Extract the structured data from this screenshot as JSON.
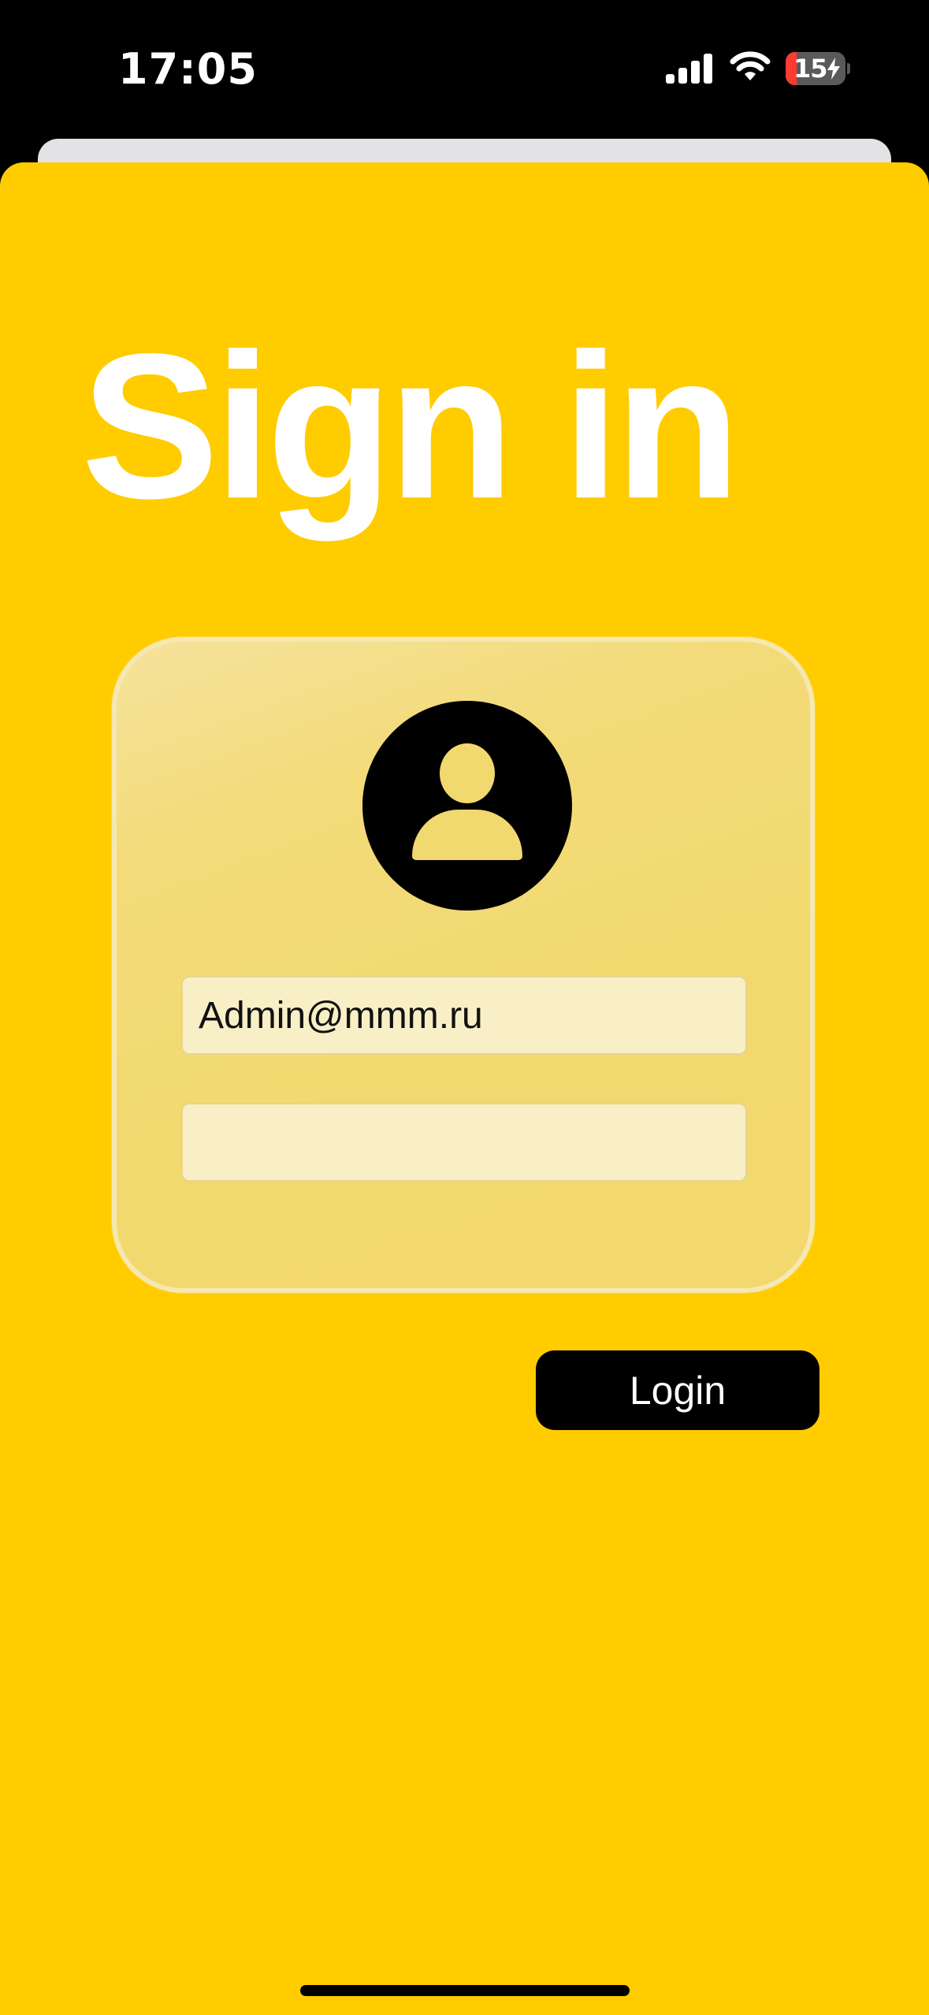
{
  "status_bar": {
    "time": "17:05",
    "battery_level": "15",
    "battery_charging": true,
    "icons": [
      "cellular-signal-icon",
      "wifi-icon",
      "battery-icon",
      "charging-bolt-icon"
    ]
  },
  "screen": {
    "title": "Sign in",
    "background_color": "#ffcc00",
    "card_color": "#f2d96f"
  },
  "form": {
    "avatar_icon": "user-avatar-icon",
    "email_value": "Admin@mmm.ru",
    "password_value": "",
    "login_label": "Login"
  }
}
